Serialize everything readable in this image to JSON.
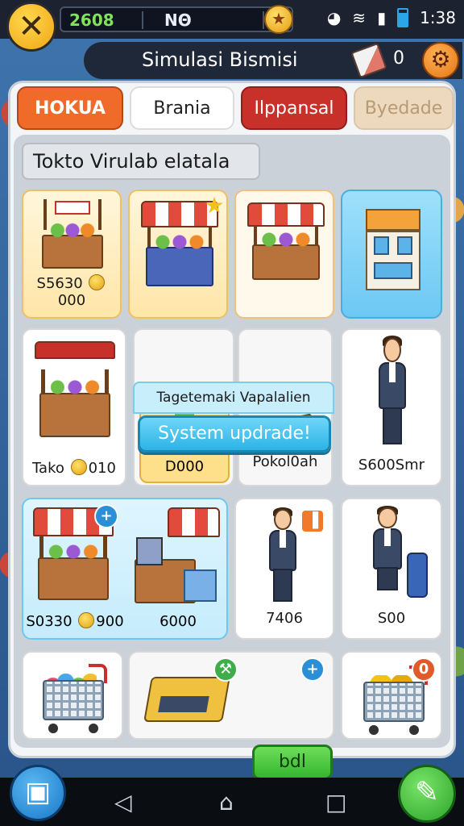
{
  "status": {
    "coins": "2608",
    "label": "NΘ",
    "time": "1:38"
  },
  "header": {
    "title": "Simulasi Bismisi",
    "count": "0"
  },
  "tabs": [
    "HOKUA",
    "Brania",
    "Ilppansal",
    "Byedade"
  ],
  "section_title": "Tokto Virulab elatala",
  "popup": {
    "heading": "Tagetemaki Vapalalien",
    "button": "System updrade!"
  },
  "cards": {
    "r1c1": "S5630 ",
    "r1c1b": "000",
    "r2c1": "Tako ",
    "r2c1b": "010",
    "r2c2": "D000",
    "r2c3": "Pokol0ah",
    "r2c4": "S600Smr",
    "r3c1": "S0330 ",
    "r3c1b": "900",
    "r3c2": "6000",
    "r3c3": "7406",
    "r3c4": "S00"
  },
  "green_button": "bdl",
  "colors": {
    "accent_orange": "#f06a2a",
    "accent_red": "#c8302a",
    "accent_blue": "#2cb3e6",
    "accent_green": "#35b42e"
  }
}
